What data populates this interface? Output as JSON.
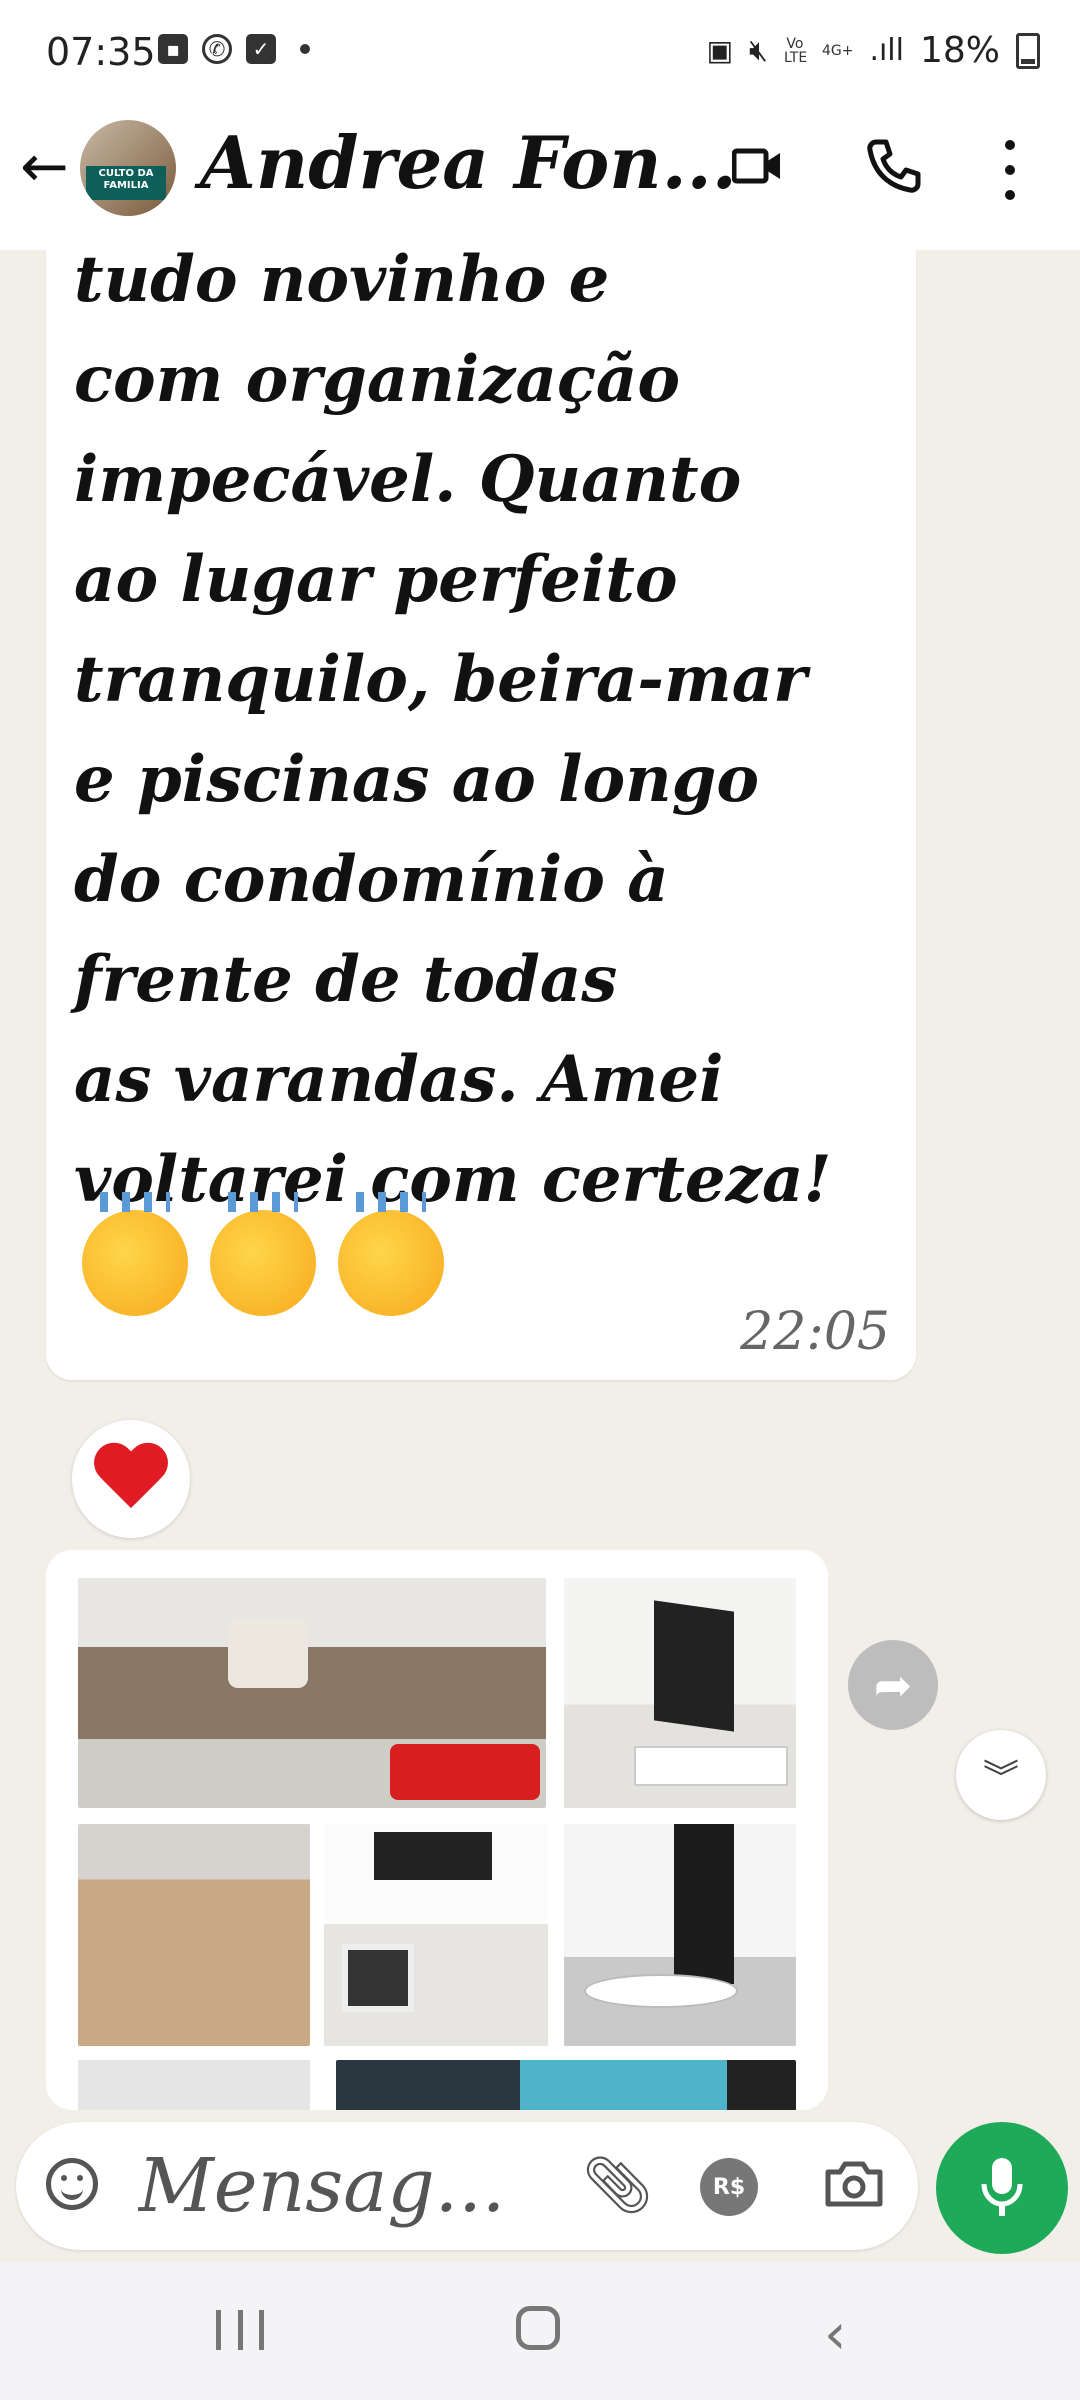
{
  "status_bar": {
    "time": "07:35",
    "signal_labels": [
      "Vo LTE",
      "4G+"
    ],
    "battery": "18%"
  },
  "header": {
    "back_icon": "arrow-left-icon",
    "avatar_badge": "CULTO DA FAMILIA",
    "contact_name": "Andrea Fon...",
    "video_icon": "video-camera-icon",
    "call_icon": "phone-icon",
    "menu_icon": "more-vertical-icon"
  },
  "message": {
    "text": "tudo novinho e\ncom organização\nimpecável. Quanto\nao lugar perfeito\ntranquilo, beira-mar\ne piscinas ao longo\ndo condomínio à\nfrente de todas\nas varandas. Amei\nvoltarei com certeza!",
    "emojis": [
      "clapping-hands",
      "clapping-hands",
      "clapping-hands"
    ],
    "time": "22:05",
    "reaction": "red-heart"
  },
  "album": {
    "photos": [
      "sofa-living-room",
      "tv-rack",
      "bedroom",
      "kitchen",
      "dining-table",
      "room",
      "pool"
    ]
  },
  "input": {
    "placeholder": "Mensag...",
    "payment_label": "R$"
  },
  "colors": {
    "chat_background": "#f2efe8",
    "bubble": "#ffffff",
    "mic_green": "#1faa59",
    "heart_red": "#e01b24"
  }
}
